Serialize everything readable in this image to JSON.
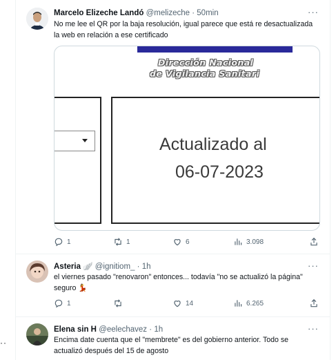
{
  "tweets": [
    {
      "name": "Marcelo Elizeche Landó",
      "handle": "@melizeche",
      "sep": "·",
      "time": "50min",
      "more": "···",
      "text": "No me lee el QR por la baja resolución, igual parece que está re desactualizada la web en relación a ese certificado",
      "media": {
        "heading_line1": "Dirección Nacional",
        "heading_line2": "de Vigilancia Sanitari",
        "updated_line1": "Actualizado al",
        "updated_line2": "06-07-2023"
      },
      "replies": "1",
      "retweets": "1",
      "likes": "6",
      "views": "3.098"
    },
    {
      "name": "Asteria",
      "name_emoji": "🪽",
      "handle": "@ignitiom_",
      "sep": "·",
      "time": "1h",
      "more": "···",
      "text": "el viernes pasado \"renovaron\" entonces... todavía \"no se actualizó la página\" seguro 💃",
      "replies": "1",
      "retweets": "",
      "likes": "14",
      "views": "6.265"
    },
    {
      "name": "Elena sin H",
      "handle": "@eelechavez",
      "sep": "·",
      "time": "1h",
      "more": "···",
      "text": "Encima date cuenta que el \"membrete\" es del gobierno anterior.  Todo se actualizó después del 15 de agosto"
    }
  ],
  "outside_more": "··",
  "icons": {
    "reply": "reply-icon",
    "retweet": "retweet-icon",
    "like": "heart-icon",
    "views": "views-icon",
    "share": "share-icon"
  },
  "colors": {
    "text": "#0f1419",
    "secondary": "#536471",
    "border": "#eff3f4",
    "banner": "#2a2a9a"
  }
}
